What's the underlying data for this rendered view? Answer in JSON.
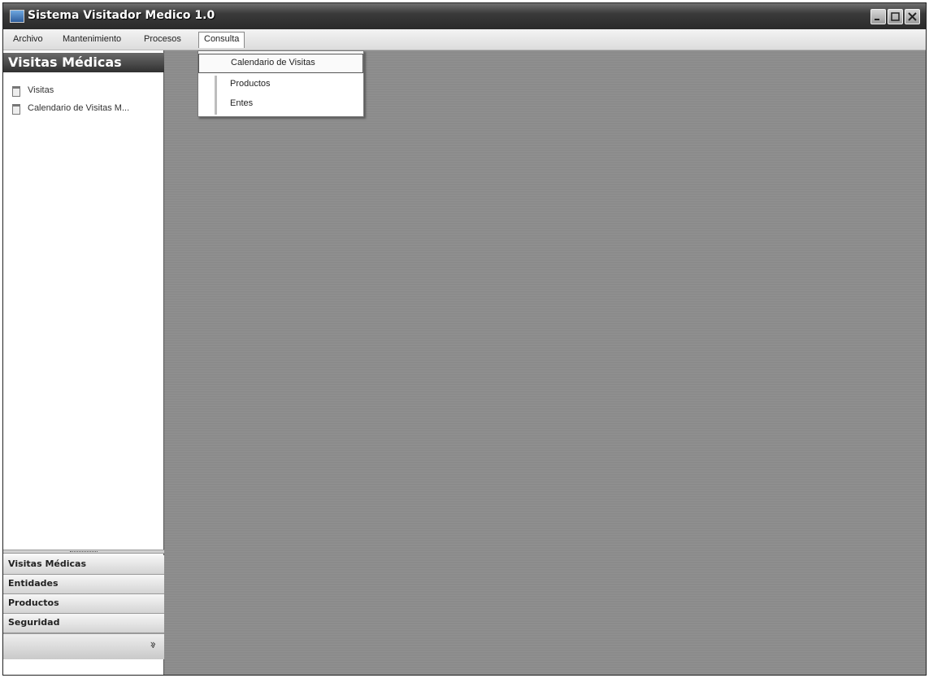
{
  "window": {
    "title": "Sistema Visitador Medico 1.0"
  },
  "menubar": {
    "items": [
      "Archivo",
      "Mantenimiento",
      "Procesos",
      "Consulta"
    ]
  },
  "dropdown": {
    "items": [
      "Calendario de Visitas",
      "Productos",
      "Entes"
    ]
  },
  "sidebar": {
    "header": "Visitas Médicas",
    "items": [
      {
        "label": "Visitas",
        "icon": "document-icon"
      },
      {
        "label": "Calendario de Visitas M...",
        "icon": "document-icon"
      }
    ],
    "sections": [
      "Visitas Médicas",
      "Entidades",
      "Productos",
      "Seguridad"
    ]
  },
  "colors": {
    "titlebar": "#333333",
    "workspace": "#8b8b8b",
    "sidebar_header": "#3c3c3c"
  }
}
